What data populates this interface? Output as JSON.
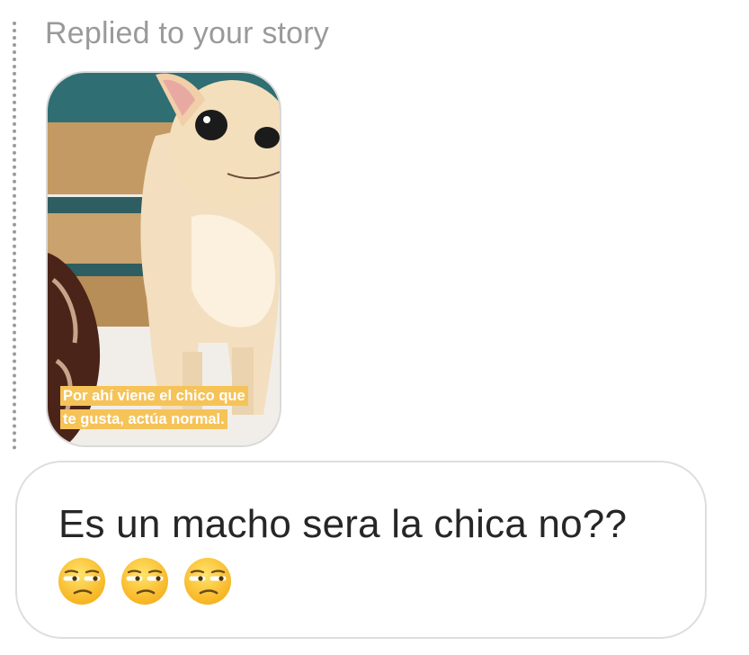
{
  "story_reply": {
    "label": "Replied to your story",
    "caption_line1": "Por ahí viene el chico que",
    "caption_line2": "te gusta, actúa normal."
  },
  "message": {
    "text": "Es un macho sera la chica no??",
    "emojis": [
      "unamused-face",
      "unamused-face",
      "unamused-face"
    ]
  },
  "colors": {
    "caption_highlight": "#f6c358",
    "label": "#9a9a9a",
    "bubble_border": "#dedede",
    "text": "#262626"
  }
}
